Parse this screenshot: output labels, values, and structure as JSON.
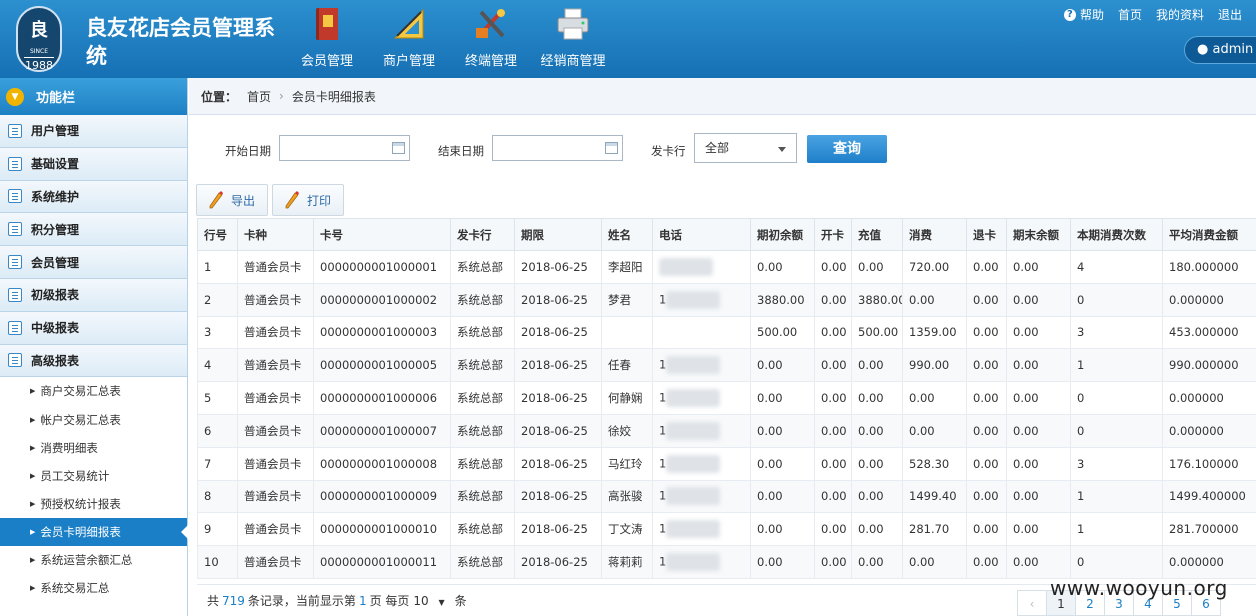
{
  "header": {
    "app_title": "良友花店会员管理系统",
    "logo": {
      "mark": "良",
      "since": "SINCE",
      "year": "1988"
    },
    "nav": [
      {
        "label": "会员管理",
        "icon": "book-icon"
      },
      {
        "label": "商户管理",
        "icon": "ruler-icon"
      },
      {
        "label": "终端管理",
        "icon": "tools-icon"
      },
      {
        "label": "经销商管理",
        "icon": "printer-icon"
      }
    ],
    "links": {
      "help": "帮助",
      "home": "首页",
      "profile": "我的资料",
      "logout": "退出"
    },
    "user": "admin"
  },
  "sidebar": {
    "title": "功能栏",
    "groups": [
      "用户管理",
      "基础设置",
      "系统维护",
      "积分管理",
      "会员管理",
      "初级报表",
      "中级报表",
      "高级报表"
    ],
    "subitems": [
      "商户交易汇总表",
      "帐户交易汇总表",
      "消费明细表",
      "员工交易统计",
      "预授权统计报表",
      "会员卡明细报表",
      "系统运营余额汇总",
      "系统交易汇总"
    ],
    "active_sub": "会员卡明细报表"
  },
  "breadcrumb": {
    "label": "位置：",
    "home": "首页",
    "current": "会员卡明细报表"
  },
  "filter": {
    "start_label": "开始日期",
    "start_value": "",
    "end_label": "结束日期",
    "end_value": "",
    "issuer_label": "发卡行",
    "issuer_value": "全部",
    "query_button": "查询"
  },
  "toolbar": {
    "export": "导出",
    "print": "打印"
  },
  "table": {
    "columns": [
      "行号",
      "卡种",
      "卡号",
      "发卡行",
      "期限",
      "姓名",
      "电话",
      "期初余额",
      "开卡",
      "充值",
      "消费",
      "退卡",
      "期末余额",
      "本期消费次数",
      "平均消费金额"
    ],
    "rows": [
      [
        "1",
        "普通会员卡",
        "0000000001000001",
        "系统总部",
        "2018-06-25",
        "李超阳",
        "",
        "0.00",
        "0.00",
        "0.00",
        "720.00",
        "0.00",
        "0.00",
        "4",
        "180.000000"
      ],
      [
        "2",
        "普通会员卡",
        "0000000001000002",
        "系统总部",
        "2018-06-25",
        "梦君",
        "1",
        "3880.00",
        "0.00",
        "3880.00",
        "0.00",
        "0.00",
        "0.00",
        "0",
        "0.000000"
      ],
      [
        "3",
        "普通会员卡",
        "0000000001000003",
        "系统总部",
        "2018-06-25",
        "",
        "",
        "500.00",
        "0.00",
        "500.00",
        "1359.00",
        "0.00",
        "0.00",
        "3",
        "453.000000"
      ],
      [
        "4",
        "普通会员卡",
        "0000000001000005",
        "系统总部",
        "2018-06-25",
        "任春",
        "1",
        "0.00",
        "0.00",
        "0.00",
        "990.00",
        "0.00",
        "0.00",
        "1",
        "990.000000"
      ],
      [
        "5",
        "普通会员卡",
        "0000000001000006",
        "系统总部",
        "2018-06-25",
        "何静娴",
        "1",
        "0.00",
        "0.00",
        "0.00",
        "0.00",
        "0.00",
        "0.00",
        "0",
        "0.000000"
      ],
      [
        "6",
        "普通会员卡",
        "0000000001000007",
        "系统总部",
        "2018-06-25",
        "徐姣",
        "1",
        "0.00",
        "0.00",
        "0.00",
        "0.00",
        "0.00",
        "0.00",
        "0",
        "0.000000"
      ],
      [
        "7",
        "普通会员卡",
        "0000000001000008",
        "系统总部",
        "2018-06-25",
        "马红玲",
        "1",
        "0.00",
        "0.00",
        "0.00",
        "528.30",
        "0.00",
        "0.00",
        "3",
        "176.100000"
      ],
      [
        "8",
        "普通会员卡",
        "0000000001000009",
        "系统总部",
        "2018-06-25",
        "高张骏",
        "1",
        "0.00",
        "0.00",
        "0.00",
        "1499.40",
        "0.00",
        "0.00",
        "1",
        "1499.400000"
      ],
      [
        "9",
        "普通会员卡",
        "0000000001000010",
        "系统总部",
        "2018-06-25",
        "丁文涛",
        "1",
        "0.00",
        "0.00",
        "0.00",
        "281.70",
        "0.00",
        "0.00",
        "1",
        "281.700000"
      ],
      [
        "10",
        "普通会员卡",
        "0000000001000011",
        "系统总部",
        "2018-06-25",
        "蒋莉莉",
        "1",
        "0.00",
        "0.00",
        "0.00",
        "0.00",
        "0.00",
        "0.00",
        "0",
        "0.000000"
      ]
    ]
  },
  "footer": {
    "prefix": "共",
    "total": "719",
    "mid": "条记录，当前显示第",
    "page": "1",
    "page_suffix": "页 每页",
    "page_size": "10",
    "unit": "条"
  },
  "pager": {
    "prev": "‹",
    "pages": [
      "1",
      "2",
      "3",
      "4",
      "5",
      "6"
    ],
    "current": "1"
  },
  "watermark": "www.wooyun.org"
}
